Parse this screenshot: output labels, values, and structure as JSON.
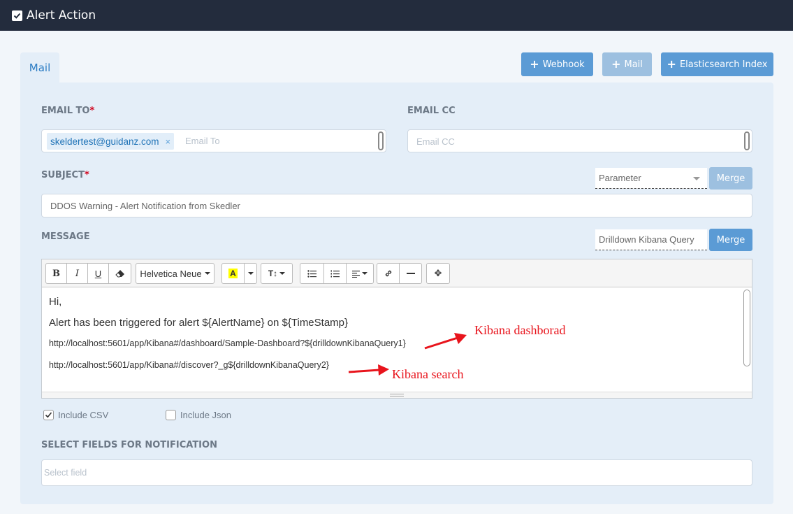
{
  "header": {
    "title": "Alert Action",
    "checked": true
  },
  "tabs": [
    {
      "label": "Mail",
      "active": true
    }
  ],
  "actions": {
    "webhook": "Webhook",
    "mail": "Mail",
    "es_index": "Elasticsearch Index"
  },
  "email_to": {
    "label": "EMAIL TO",
    "required_mark": "*",
    "tags": [
      "skeldertest@guidanz.com"
    ],
    "placeholder": "Email To",
    "remove_glyph": "×"
  },
  "email_cc": {
    "label": "EMAIL CC",
    "placeholder": "Email CC"
  },
  "subject": {
    "label": "SUBJECT",
    "required_mark": "*",
    "value": "DDOS Warning - Alert Notification from Skedler",
    "parameter_select": "Parameter",
    "merge_label": "Merge"
  },
  "message": {
    "label": "MESSAGE",
    "drilldown_select": "Drilldown Kibana Query",
    "merge_label": "Merge",
    "toolbar": {
      "font": "Helvetica Neue"
    },
    "body": {
      "line1": "Hi,",
      "line2": "Alert has been triggered for alert ${AlertName} on ${TimeStamp}",
      "line3": "http://localhost:5601/app/Kibana#/dashboard/Sample-Dashboard?${drilldownKibanaQuery1}",
      "line4": "http://localhost:5601/app/Kibana#/discover?_g${drilldownKibanaQuery2}"
    },
    "annotations": {
      "dashboard": "Kibana dashborad",
      "search": "Kibana search"
    }
  },
  "attachments": {
    "include_csv": {
      "label": "Include CSV",
      "checked": true
    },
    "include_json": {
      "label": "Include Json",
      "checked": false
    }
  },
  "fields": {
    "label": "SELECT FIELDS FOR NOTIFICATION",
    "placeholder": "Select field"
  },
  "colors": {
    "header_bg": "#232c3d",
    "accent": "#5b9bd5",
    "required": "#d0021b",
    "annotation": "#e8141c"
  }
}
